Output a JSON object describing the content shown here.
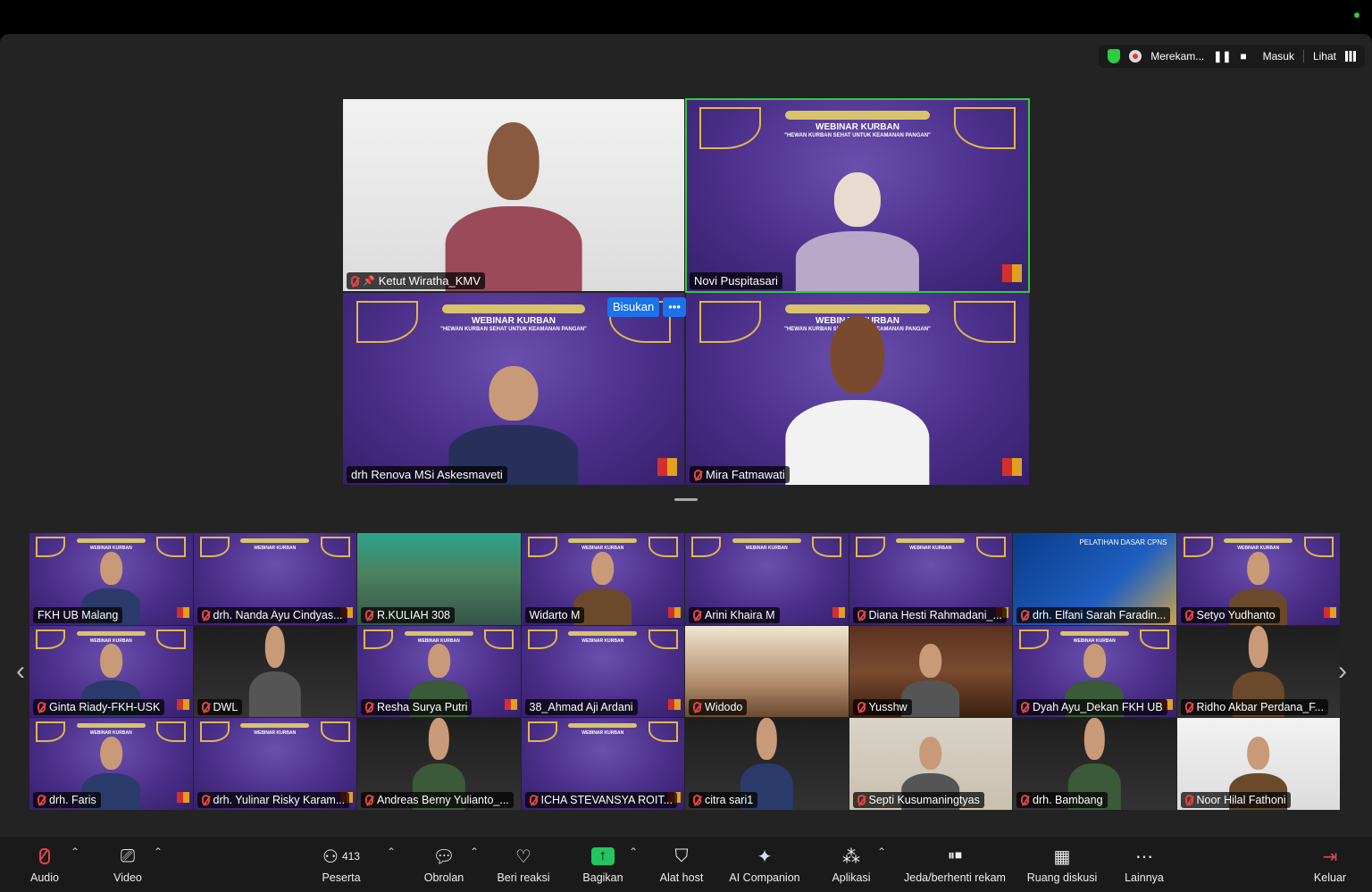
{
  "status": {
    "recording": "Merekam...",
    "signin": "Masuk",
    "view": "Lihat"
  },
  "main_tiles": [
    {
      "name": "Ketut Wiratha_KMV"
    },
    {
      "name": "Novi Puspitasari"
    },
    {
      "name": "drh Renova MSi Askesmaveti"
    },
    {
      "name": "Mira Fatmawati"
    }
  ],
  "bisukan": {
    "label": "Bisukan",
    "more": "•••"
  },
  "banner": {
    "title": "WEBINAR KURBAN",
    "subtitle": "\"HEWAN KURBAN SEHAT UNTUK KEAMANAN PANGAN\""
  },
  "gallery": [
    {
      "name": "FKH UB Malang"
    },
    {
      "name": "drh. Nanda Ayu Cindyas..."
    },
    {
      "name": "R.KULIAH 308"
    },
    {
      "name": "Widarto M"
    },
    {
      "name": "Arini Khaira M"
    },
    {
      "name": "Diana Hesti Rahmadani_..."
    },
    {
      "name": "drh. Elfani Sarah Faradin..."
    },
    {
      "name": "Setyo Yudhanto"
    },
    {
      "name": "Ginta Riady-FKH-USK"
    },
    {
      "name": "DWL"
    },
    {
      "name": "Resha Surya Putri"
    },
    {
      "name": "38_Ahmad Aji Ardani"
    },
    {
      "name": "Widodo"
    },
    {
      "name": "Yusshw"
    },
    {
      "name": "Dyah Ayu_Dekan FKH UB"
    },
    {
      "name": "Ridho Akbar Perdana_F..."
    },
    {
      "name": "drh. Faris"
    },
    {
      "name": "drh. Yulinar Risky Karam..."
    },
    {
      "name": "Andreas Berny Yulianto_..."
    },
    {
      "name": "ICHA STEVANSYA ROIT..."
    },
    {
      "name": "citra sari1"
    },
    {
      "name": "Septi Kusumaningtyas"
    },
    {
      "name": "drh. Bambang"
    },
    {
      "name": "Noor Hilal Fathoni"
    }
  ],
  "elfani_banner": "PELATIHAN DASAR CPNS",
  "toolbar": {
    "audio": "Audio",
    "video": "Video",
    "participants": "Peserta",
    "participants_count": "413",
    "chat": "Obrolan",
    "react": "Beri reaksi",
    "share": "Bagikan",
    "host_tools": "Alat host",
    "ai": "AI Companion",
    "apps": "Aplikasi",
    "pause_stop": "Jeda/berhenti rekam",
    "breakout": "Ruang diskusi",
    "more": "Lainnya",
    "leave": "Keluar"
  },
  "colors": {
    "accent_green": "#2ecc40",
    "share_green": "#22c55e",
    "blue": "#1a73e8",
    "mute_red": "#e04545"
  }
}
